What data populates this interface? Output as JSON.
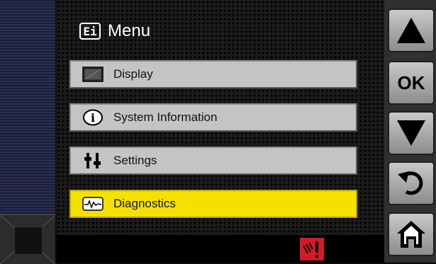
{
  "header": {
    "icon_text": "Ei",
    "title": "Menu"
  },
  "menu": {
    "items": [
      {
        "label": "Display",
        "icon": "display-icon",
        "selected": false
      },
      {
        "label": "System Information",
        "icon": "info-icon",
        "selected": false
      },
      {
        "label": "Settings",
        "icon": "settings-icon",
        "selected": false
      },
      {
        "label": "Diagnostics",
        "icon": "diagnostics-icon",
        "selected": true
      }
    ]
  },
  "buttons": {
    "up": "arrow-up-icon",
    "ok": "OK",
    "down": "arrow-down-icon",
    "back": "back-icon",
    "home": "home-icon"
  },
  "status": {
    "warning_icon": "audio-warning-icon"
  },
  "colors": {
    "selected": "#f6e000",
    "item": "#c4c4c4",
    "warning": "#d41a2a"
  }
}
